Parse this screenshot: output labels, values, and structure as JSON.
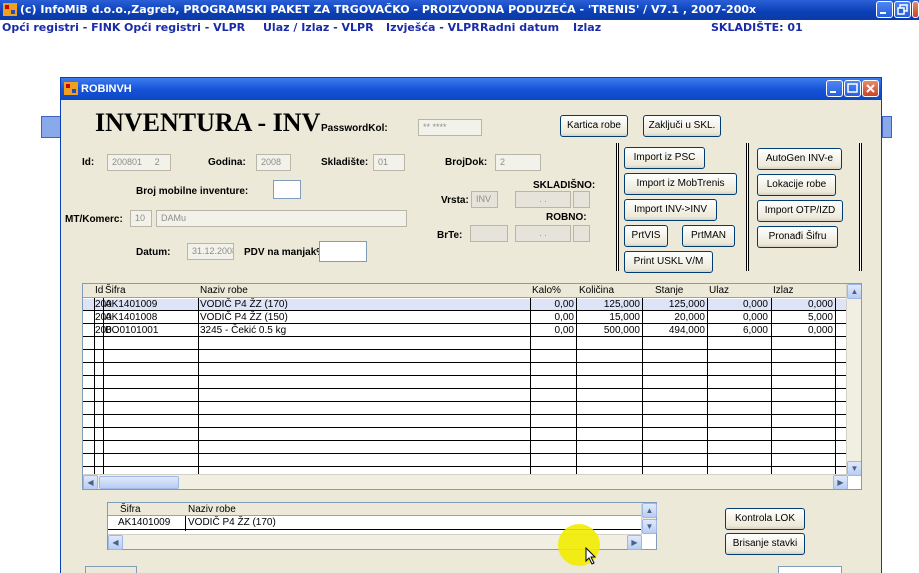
{
  "app": {
    "title": "(c) InfoMiB d.o.o.,Zagreb, PROGRAMSKI PAKET ZA TRGOVAČKO - PROIZVODNA PODUZEĆA - 'TRENIS' / V7.1 , 2007-200x"
  },
  "menu": {
    "items": [
      "Opći registri - FINK",
      "Opći registri - VLPR",
      "Ulaz / Izlaz - VLPR",
      "Izvješća - VLPR",
      "Radni datum",
      "Izlaz"
    ],
    "skladiste": "SKLADIŠTE: 01"
  },
  "window": {
    "title": "ROBINVH",
    "heading": "INVENTURA - INV"
  },
  "form": {
    "password_label": "PasswordKol:",
    "password_value": "** ****",
    "id_label": "Id:",
    "id_value1": "200801",
    "id_value2": "2",
    "godina_label": "Godina:",
    "godina_value": "2008",
    "skladiste_label": "Skladište:",
    "skladiste_value": "01",
    "brojdok_label": "BrojDok:",
    "brojdok_value": "2",
    "broj_mob_label": "Broj mobilne inventure:",
    "skladisno_label": "SKLADIŠNO:",
    "vrsta_label": "Vrsta:",
    "vrsta_value": "INV",
    "robno_label": "ROBNO:",
    "mt_label": "MT/Komerc:",
    "mt_value": "10",
    "mt_name": "DAMu",
    "brte_label": "BrTe:",
    "datum_label": "Datum:",
    "datum_value": "31.12.2008",
    "pdv_label": "PDV na manjak%:",
    "dots1": ". .",
    "dots2": ". ."
  },
  "buttons": {
    "kartica": "Kartica robe",
    "zakljuci": "Zaključi u SKL.",
    "import_psc": "Import iz PSC",
    "import_mob": "Import iz MobTrenis",
    "import_inv": "Import INV->INV",
    "prtvis": "PrtVIS",
    "prtman": "PrtMAN",
    "print_uskl": "Print USKL V/M",
    "autogen": "AutoGen INV-e",
    "lokacije": "Lokacije robe",
    "import_otp": "Import OTP/IZD",
    "pronadi": "Pronađi Šifru",
    "kontrola": "Kontrola LOK",
    "brisanje": "Brisanje stavki"
  },
  "grid": {
    "headers": [
      "Id",
      "Šifra",
      "Naziv robe",
      "Kalo%",
      "Količina",
      "Stanje",
      "Ulaz",
      "Izlaz"
    ],
    "rows": [
      {
        "id": "200",
        "sifra": "AK1401009",
        "naziv": "VODIČ  P4 ŽZ (170)",
        "kalo": "0,00",
        "kolicina": "125,000",
        "stanje": "125,000",
        "ulaz": "0,000",
        "izlaz": "0,000"
      },
      {
        "id": "200",
        "sifra": "AK1401008",
        "naziv": "VODIČ  P4 ŽZ (150)",
        "kalo": "0,00",
        "kolicina": "15,000",
        "stanje": "20,000",
        "ulaz": "0,000",
        "izlaz": "5,000"
      },
      {
        "id": "200",
        "sifra": "BO0101001",
        "naziv": "3245 - Čekić 0.5 kg",
        "kalo": "0,00",
        "kolicina": "500,000",
        "stanje": "494,000",
        "ulaz": "6,000",
        "izlaz": "0,000"
      }
    ]
  },
  "mini_grid": {
    "headers": [
      "Šifra",
      "Naziv robe"
    ],
    "row": {
      "sifra": "AK1401009",
      "naziv": "VODIČ  P4 ŽZ (170)"
    }
  },
  "colors": {
    "title_blue": "#0a3fb5",
    "menu_text": "#1a2aa8",
    "window_bg": "#ece9d8",
    "close_red": "#c8452a"
  }
}
